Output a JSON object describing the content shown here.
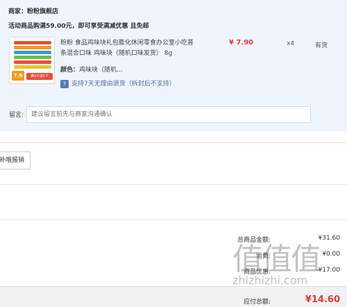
{
  "order": {
    "merchant_label": "商家：",
    "merchant_name": "粉粉旗舰店",
    "promo_text": "活动商品购满59.00元，即可享受满减优惠 且免邮",
    "product": {
      "title": "粉粉 食品鸡味块礼包膨化休闲零食办公室小吃普条混合口味 鸡味块（随机口味发货） 8g",
      "price": "¥ 7.90",
      "quantity": "x4",
      "stock_status": "有货",
      "attr_label": "颜色：",
      "attr_value": "鸡味块（随机...",
      "return_policy": "支持7天无理由退货（拆封后不支持）",
      "thumb_badge": "7.9",
      "thumb_footer": "满5个送1个",
      "thumb_colors": [
        "#e84c3d",
        "#f39a1e",
        "#3a9ad9",
        "#6bbd45",
        "#e84c3d",
        "#f2c12e"
      ]
    },
    "note_label": "留言:",
    "note_placeholder": "建议留言前先与商家沟通确认"
  },
  "invoice_button": "补哦报销",
  "summary": {
    "goods_total_label": "总商品金额:",
    "goods_total_value": "¥31.60",
    "shipping_label": "运费:",
    "shipping_value": "¥0.00",
    "discount_label": "商品优惠:",
    "discount_value": "-¥17.00",
    "payable_label": "应付总额:",
    "payable_value": "¥14.60"
  },
  "watermark": {
    "glyphs": "值值值",
    "site": "zhizhizhi.com"
  }
}
